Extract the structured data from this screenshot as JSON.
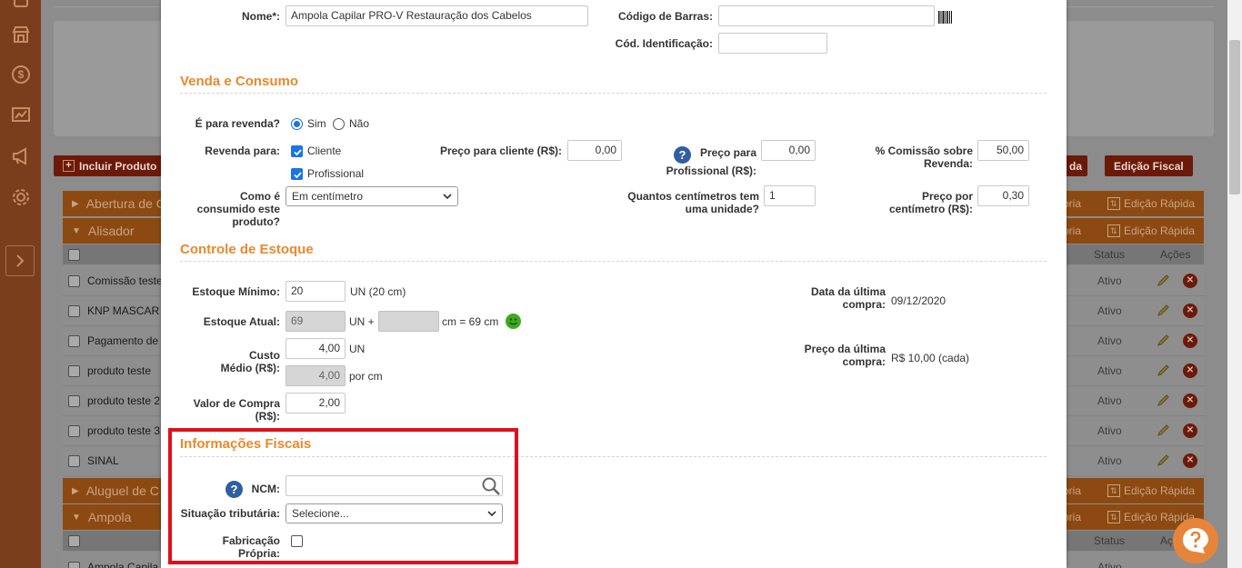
{
  "background": {
    "buttons": {
      "include_product": "Incluir Produto",
      "fiscal_edit": "Edição Fiscal",
      "partial_right": "da"
    },
    "categories": [
      {
        "name": "Abertura de C",
        "cat_link": "oria",
        "quick_edit": "Edição Rápida"
      },
      {
        "name": "Alisador",
        "cat_link": "oria",
        "quick_edit": "Edição Rápida"
      },
      {
        "name": "Aluguel de C",
        "cat_link": "oria",
        "quick_edit": "Edição Rápida"
      },
      {
        "name": "Ampola",
        "cat_link": "oria",
        "quick_edit": "Edição Rápida"
      }
    ],
    "table_headers": {
      "status": "Status",
      "actions": "Ações",
      "actions_partial": "Aç"
    },
    "rows": [
      {
        "name": "Comissão teste",
        "status": "Ativo"
      },
      {
        "name": "KNP MASCAR",
        "status": "Ativo"
      },
      {
        "name": "Pagamento de",
        "status": "Ativo"
      },
      {
        "name": "produto teste",
        "status": "Ativo"
      },
      {
        "name": "produto teste 2",
        "status": "Ativo"
      },
      {
        "name": "produto teste 3",
        "status": "Ativo"
      },
      {
        "name": "SINAL",
        "status": "Ativo"
      }
    ],
    "last_row": {
      "name": "Ampola Capila",
      "status": "Ativo"
    }
  },
  "form": {
    "name_label": "Nome*:",
    "name_value": "Ampola Capilar PRO-V Restauração dos Cabelos",
    "barcode_label": "Código de Barras:",
    "barcode_value": "",
    "id_code_label": "Cód. Identificação:",
    "id_code_value": ""
  },
  "sales": {
    "title": "Venda e Consumo",
    "resale_label": "É para revenda?",
    "resale_yes": "Sim",
    "resale_no": "Não",
    "resale_selected": "Sim",
    "resale_for_label": "Revenda para:",
    "client_label": "Cliente",
    "professional_label": "Profissional",
    "client_price_label": "Preço para cliente (R$):",
    "client_price_value": "0,00",
    "prof_price_label_1": "Preço para",
    "prof_price_label_2": "Profissional (R$):",
    "prof_price_value": "0,00",
    "commission_label_1": "% Comissão sobre",
    "commission_label_2": "Revenda:",
    "commission_value": "50,00",
    "consumed_label_1": "Como é",
    "consumed_label_2": "consumido este",
    "consumed_label_3": "produto?",
    "consumed_value": "Em centímetro",
    "units_label_1": "Quantos centímetros tem",
    "units_label_2": "uma unidade?",
    "units_value": "1",
    "price_per_cm_label_1": "Preço por",
    "price_per_cm_label_2": "centímetro (R$):",
    "price_per_cm_value": "0,30"
  },
  "stock": {
    "title": "Controle de Estoque",
    "min_label": "Estoque Mínimo:",
    "min_value": "20",
    "min_suffix": "UN  (20 cm)",
    "current_label": "Estoque Atual:",
    "current_value": "69",
    "current_plus": "UN +",
    "current_cm_value": "",
    "current_suffix": "cm = 69 cm",
    "avg_cost_label_1": "Custo",
    "avg_cost_label_2": "Médio (R$):",
    "avg_cost_value": "4,00",
    "avg_cost_unit": "UN",
    "avg_cost_cm_value": "4,00",
    "avg_cost_cm_unit": "por cm",
    "purchase_label_1": "Valor de Compra",
    "purchase_label_2": "(R$):",
    "purchase_value": "2,00",
    "last_purchase_date_label_1": "Data da última",
    "last_purchase_date_label_2": "compra:",
    "last_purchase_date": "09/12/2020",
    "last_purchase_price_label_1": "Preço da última",
    "last_purchase_price_label_2": "compra:",
    "last_purchase_price": "R$ 10,00 (cada)"
  },
  "fiscal": {
    "title": "Informações Fiscais",
    "ncm_label": "NCM:",
    "ncm_value": "",
    "tax_label": "Situação tributária:",
    "tax_value": "Selecione...",
    "own_manufacture_label_1": "Fabricação",
    "own_manufacture_label_2": "Própria:"
  },
  "colors": {
    "accent": "#e8892d",
    "highlight": "#e0101a",
    "checkbox_blue": "#1a73e8",
    "help_blue": "#2f5fa0"
  }
}
